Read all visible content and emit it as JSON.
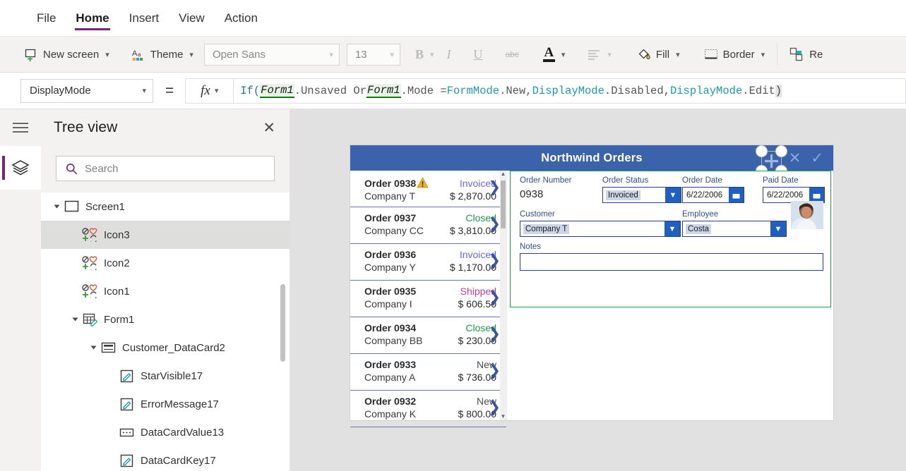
{
  "menu": {
    "items": [
      {
        "label": "File",
        "active": false
      },
      {
        "label": "Home",
        "active": true
      },
      {
        "label": "Insert",
        "active": false
      },
      {
        "label": "View",
        "active": false
      },
      {
        "label": "Action",
        "active": false
      }
    ]
  },
  "ribbon": {
    "new_screen": "New screen",
    "theme": "Theme",
    "font_family": "Open Sans",
    "font_size": "13",
    "bold": "B",
    "italic": "I",
    "underline": "U",
    "strikethrough": "abc",
    "font_color": "A",
    "fill": "Fill",
    "border": "Border",
    "reorder": "Re"
  },
  "formula": {
    "property": "DisplayMode",
    "equals": "=",
    "fx": "fx",
    "tokens": [
      {
        "t": "If(",
        "k": "fn-open"
      },
      {
        "t": "Form1",
        "k": "ctl"
      },
      {
        "t": ".Unsaved Or ",
        "k": "kw"
      },
      {
        "t": "Form1",
        "k": "ctl"
      },
      {
        "t": ".Mode = ",
        "k": "kw"
      },
      {
        "t": "FormMode",
        "k": "enum"
      },
      {
        "t": ".New, ",
        "k": "kw"
      },
      {
        "t": "DisplayMode",
        "k": "enum"
      },
      {
        "t": ".Disabled, ",
        "k": "kw"
      },
      {
        "t": "DisplayMode",
        "k": "enum"
      },
      {
        "t": ".Edit ",
        "k": "kw"
      },
      {
        "t": ")",
        "k": "paren"
      }
    ],
    "full_text": "If( Form1.Unsaved Or Form1.Mode = FormMode.New, DisplayMode.Disabled, DisplayMode.Edit )"
  },
  "treeview": {
    "title": "Tree view",
    "search_placeholder": "Search",
    "search_value": "",
    "nodes": [
      {
        "label": "Screen1",
        "depth": 0,
        "expandable": true,
        "icon": "screen-icon",
        "selected": false
      },
      {
        "label": "Icon3",
        "depth": 1,
        "expandable": false,
        "icon": "icon-control",
        "selected": true
      },
      {
        "label": "Icon2",
        "depth": 1,
        "expandable": false,
        "icon": "icon-control",
        "selected": false
      },
      {
        "label": "Icon1",
        "depth": 1,
        "expandable": false,
        "icon": "icon-control",
        "selected": false
      },
      {
        "label": "Form1",
        "depth": 1,
        "expandable": true,
        "icon": "form-icon",
        "selected": false
      },
      {
        "label": "Customer_DataCard2",
        "depth": 2,
        "expandable": true,
        "icon": "datacard-icon",
        "selected": false
      },
      {
        "label": "StarVisible17",
        "depth": 3,
        "expandable": false,
        "icon": "label-icon",
        "selected": false
      },
      {
        "label": "ErrorMessage17",
        "depth": 3,
        "expandable": false,
        "icon": "label-icon",
        "selected": false
      },
      {
        "label": "DataCardValue13",
        "depth": 3,
        "expandable": false,
        "icon": "dropdown-icon",
        "selected": false
      },
      {
        "label": "DataCardKey17",
        "depth": 3,
        "expandable": false,
        "icon": "label-icon",
        "selected": false
      }
    ]
  },
  "app": {
    "title": "Northwind Orders",
    "header_color": "#3a63ac",
    "header_icons": [
      "plus-icon",
      "cancel-icon",
      "check-icon"
    ],
    "gallery": [
      {
        "order": "Order 0938",
        "company": "Company T",
        "status": "Invoiced",
        "amount": "$ 2,870.00",
        "warning": true
      },
      {
        "order": "Order 0937",
        "company": "Company CC",
        "status": "Closed",
        "amount": "$ 3,810.00",
        "warning": false
      },
      {
        "order": "Order 0936",
        "company": "Company Y",
        "status": "Invoiced",
        "amount": "$ 1,170.00",
        "warning": false
      },
      {
        "order": "Order 0935",
        "company": "Company I",
        "status": "Shipped",
        "amount": "$ 606.50",
        "warning": false
      },
      {
        "order": "Order 0934",
        "company": "Company BB",
        "status": "Closed",
        "amount": "$ 230.00",
        "warning": false
      },
      {
        "order": "Order 0933",
        "company": "Company A",
        "status": "New",
        "amount": "$ 736.00",
        "warning": false
      },
      {
        "order": "Order 0932",
        "company": "Company K",
        "status": "New",
        "amount": "$ 800.00",
        "warning": false
      }
    ],
    "form": {
      "order_number_label": "Order Number",
      "order_number_value": "0938",
      "order_status_label": "Order Status",
      "order_status_value": "Invoiced",
      "order_date_label": "Order Date",
      "order_date_value": "6/22/2006",
      "paid_date_label": "Paid Date",
      "paid_date_value": "6/22/2006",
      "customer_label": "Customer",
      "customer_value": "Company T",
      "employee_label": "Employee",
      "employee_value": "Costa",
      "notes_label": "Notes",
      "notes_value": ""
    }
  },
  "colors": {
    "accent": "#742774",
    "app_header": "#3a63ac",
    "selection_green": "#21a03f",
    "status_invoiced": "#6a6ae0",
    "status_closed": "#1e9e4a",
    "status_shipped": "#c23fa8",
    "status_new": "#4a4a4a"
  }
}
